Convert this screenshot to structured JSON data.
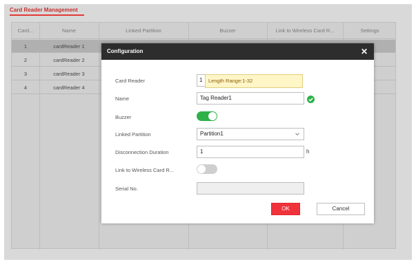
{
  "tab": {
    "label": "Card Reader Management"
  },
  "table": {
    "columns": [
      "Card...",
      "Name",
      "Linked Partition",
      "Buzzer",
      "Link to Wireless Card R...",
      "Settings"
    ],
    "rows": [
      {
        "no": "1",
        "name": "cardReader 1"
      },
      {
        "no": "2",
        "name": "cardReader 2"
      },
      {
        "no": "3",
        "name": "cardReader 3"
      },
      {
        "no": "4",
        "name": "cardReader 4"
      }
    ]
  },
  "dialog": {
    "title": "Configuration",
    "close": "✕",
    "fields": {
      "card_reader": {
        "label": "Card Reader",
        "value": "1",
        "tooltip": "Length Range:1-32"
      },
      "name": {
        "label": "Name",
        "value": "Tag Reader1"
      },
      "buzzer": {
        "label": "Buzzer",
        "state": "on"
      },
      "linked_partition": {
        "label": "Linked Partition",
        "value": "Partition1"
      },
      "disconnection_duration": {
        "label": "Disconnection Duration",
        "value": "1",
        "unit": "h"
      },
      "link_wireless": {
        "label": "Link to Wireless Card R...",
        "state": "off"
      },
      "serial_no": {
        "label": "Serial No.",
        "value": ""
      }
    },
    "ok_label": "OK",
    "cancel_label": "Cancel"
  },
  "colors": {
    "accent": "#e23a35",
    "toggle_on": "#2fb14a",
    "header": "#2d2d2d"
  },
  "icons": {
    "check": "check-circle-icon",
    "dropdown": "chevron-down-icon",
    "close": "close-icon"
  }
}
